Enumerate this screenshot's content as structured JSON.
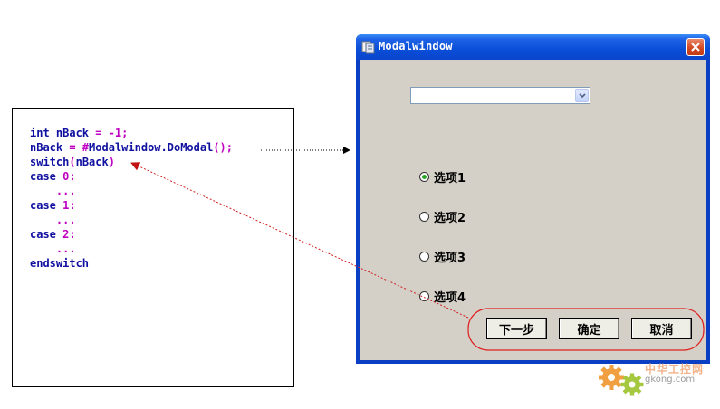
{
  "code": {
    "lines": [
      {
        "parts": [
          {
            "t": "int nBack ",
            "c": "kw"
          },
          {
            "t": "= -1;",
            "c": "op"
          }
        ]
      },
      {
        "parts": [
          {
            "t": "nBack ",
            "c": "id"
          },
          {
            "t": "= #",
            "c": "op"
          },
          {
            "t": "Modalwindow.DoModal",
            "c": "id"
          },
          {
            "t": "();",
            "c": "op"
          }
        ]
      },
      {
        "parts": [
          {
            "t": "switch",
            "c": "kw"
          },
          {
            "t": "(",
            "c": "op"
          },
          {
            "t": "nBack",
            "c": "id"
          },
          {
            "t": ")",
            "c": "op"
          }
        ]
      },
      {
        "parts": [
          {
            "t": "case ",
            "c": "kw"
          },
          {
            "t": "0:",
            "c": "num"
          }
        ]
      },
      {
        "parts": [
          {
            "t": "    ...",
            "c": "dots"
          }
        ]
      },
      {
        "parts": [
          {
            "t": "case ",
            "c": "kw"
          },
          {
            "t": "1:",
            "c": "num"
          }
        ]
      },
      {
        "parts": [
          {
            "t": "    ...",
            "c": "dots"
          }
        ]
      },
      {
        "parts": [
          {
            "t": "case ",
            "c": "kw"
          },
          {
            "t": "2:",
            "c": "num"
          }
        ]
      },
      {
        "parts": [
          {
            "t": "    ...",
            "c": "dots"
          }
        ]
      },
      {
        "parts": [
          {
            "t": "endswitch",
            "c": "kw"
          }
        ]
      }
    ]
  },
  "window": {
    "title": "Modalwindow",
    "close_icon": "close-icon",
    "combo": {
      "value": ""
    },
    "radios": [
      {
        "label": "选项1",
        "checked": true
      },
      {
        "label": "选项2",
        "checked": false
      },
      {
        "label": "选项3",
        "checked": false
      },
      {
        "label": "选项4",
        "checked": false
      }
    ],
    "buttons": {
      "next": "下一步",
      "ok": "确定",
      "cancel": "取消"
    }
  },
  "watermark": {
    "text": "中华工控网",
    "url": "gkong.com"
  },
  "colors": {
    "annotation_red": "#e02020",
    "titlebar_blue": "#0a4ed8",
    "client_gray": "#d4d0c8"
  }
}
